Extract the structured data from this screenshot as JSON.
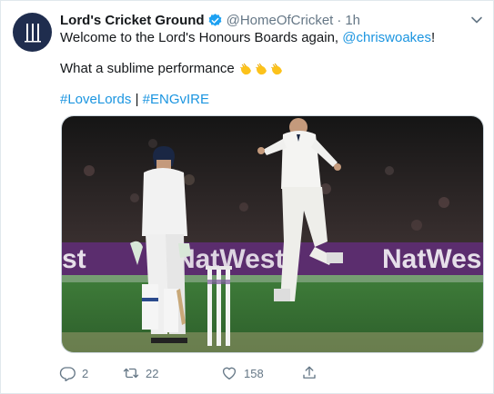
{
  "tweet": {
    "author_name": "Lord's Cricket Ground",
    "handle": "@HomeOfCricket",
    "separator": "·",
    "time": "1h",
    "line1_text": "Welcome to the Lord's Honours Boards again, ",
    "line1_mention": "@chriswoakes",
    "line1_suffix": "!",
    "line2_text": "What a sublime performance",
    "hashtag1": "#LoveLords",
    "hashtag_separator": " | ",
    "hashtag2": "#ENGvIRE"
  },
  "media": {
    "board_text_left": "st",
    "board_text_middle": "NatWest",
    "board_text_right": "NatWes"
  },
  "actions": {
    "reply_count": "2",
    "retweet_count": "22",
    "like_count": "158"
  },
  "icons": [
    "lords-logo-icon",
    "verified-icon",
    "chevron-down-icon",
    "clapping-hands-icon",
    "reply-icon",
    "retweet-icon",
    "like-icon",
    "share-icon"
  ],
  "colors": {
    "link": "#1b95e0",
    "verified": "#1da1f2",
    "secondary_text": "#657786",
    "avatar_bg": "#1f2d4e"
  }
}
